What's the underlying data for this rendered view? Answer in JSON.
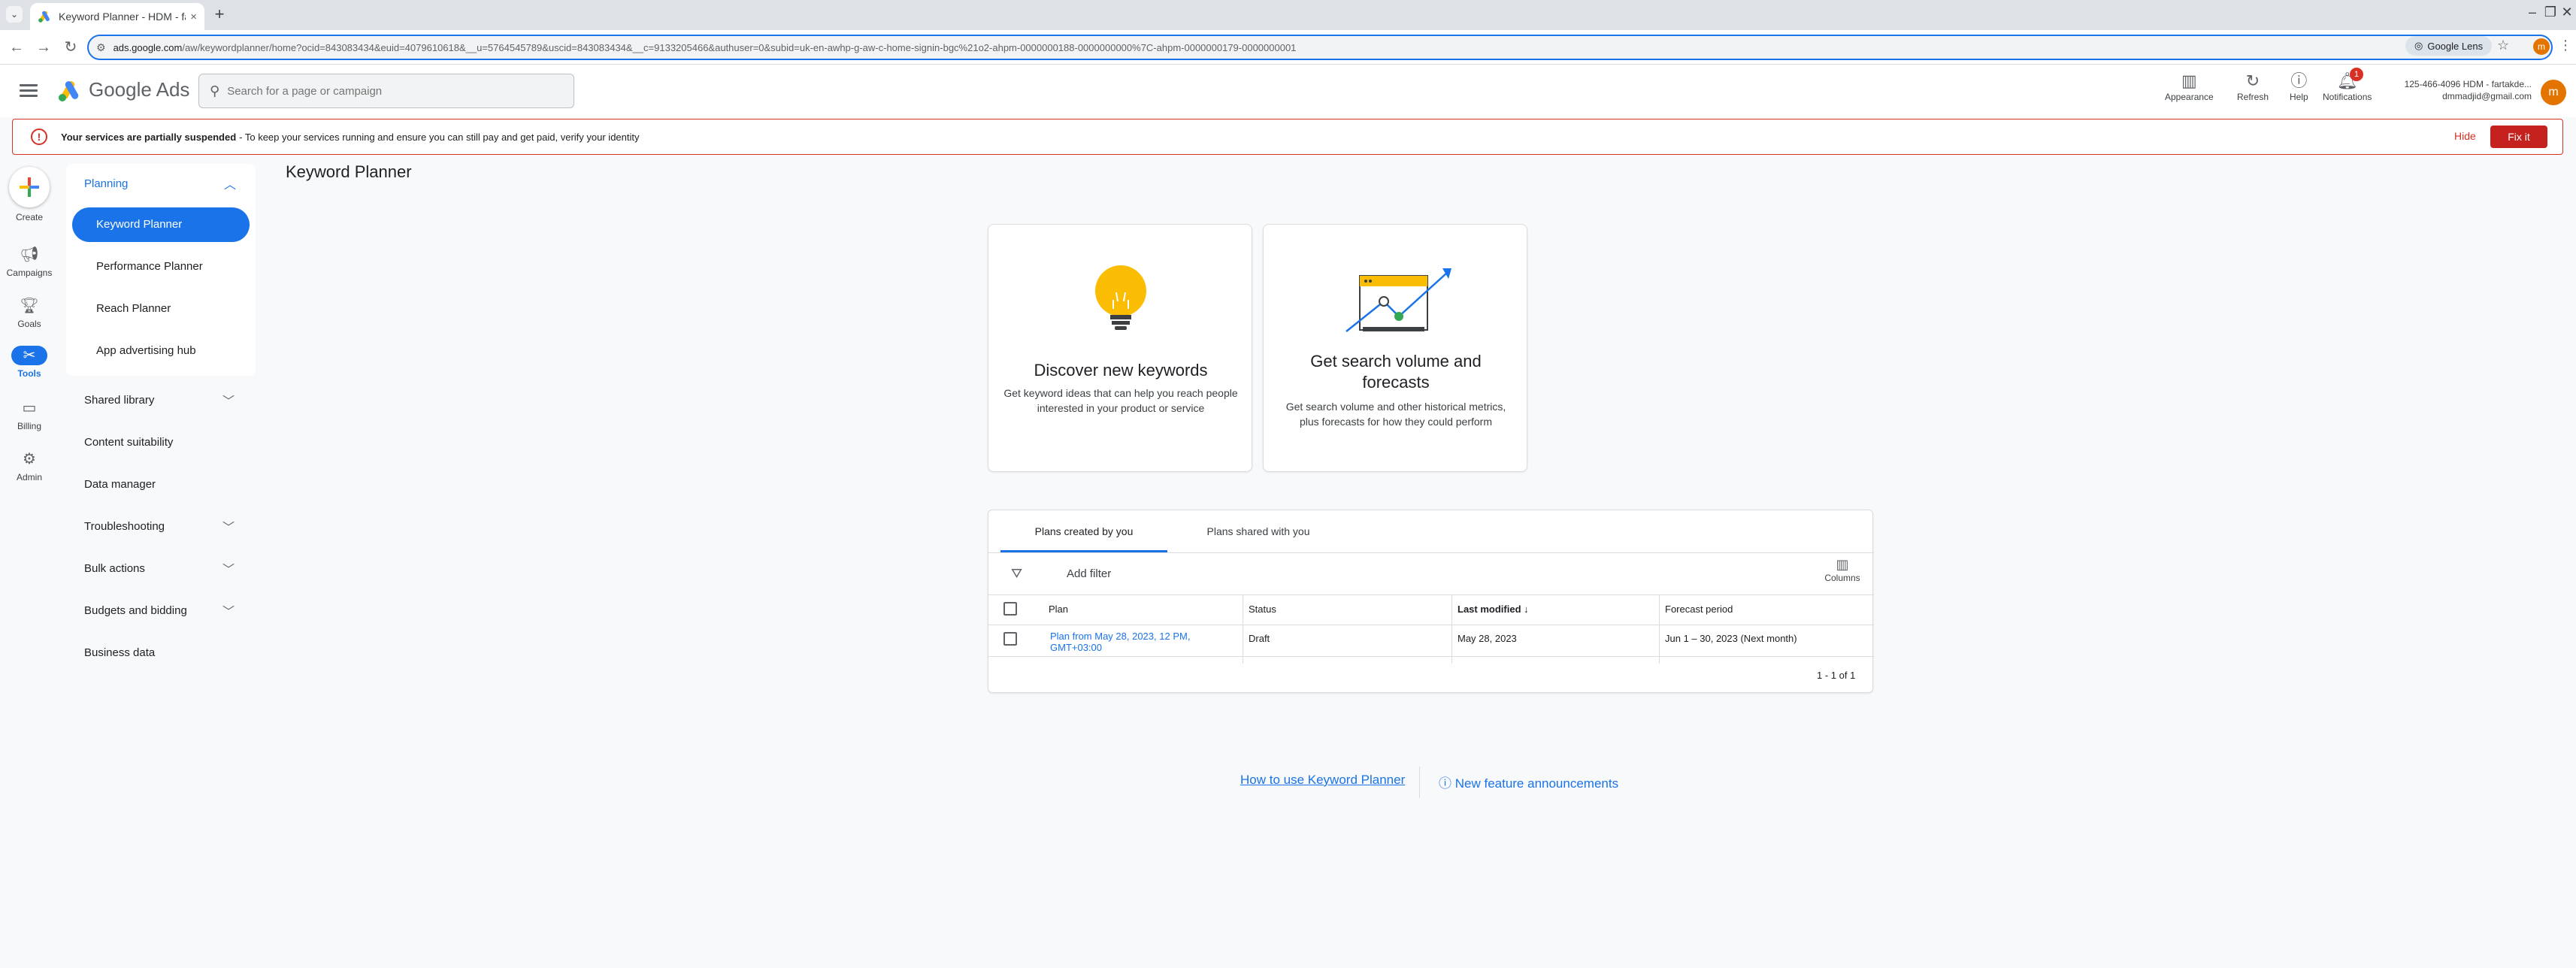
{
  "browser": {
    "tab_title": "Keyword Planner - HDM - farta...",
    "tab_close": "×",
    "tab_list": "⌄",
    "new_tab": "+",
    "url_host": "ads.google.com",
    "url_path": "/aw/keywordplanner/home?ocid=843083434&euid=4079610618&__u=5764545789&uscid=843083434&__c=9133205466&authuser=0&subid=uk-en-awhp-g-aw-c-home-signin-bgc%21o2-ahpm-0000000188-0000000000%7C-ahpm-0000000179-0000000001",
    "lens_label": "Google Lens",
    "profile_initial": "m",
    "icons": {
      "back": "arrow-left",
      "forward": "arrow-right",
      "reload": "reload",
      "star": "star",
      "menu": "kebab"
    }
  },
  "header": {
    "brand": "Google Ads",
    "search_placeholder": "Search for a page or campaign",
    "actions": [
      {
        "label": "Appearance",
        "icon": "appearance-icon"
      },
      {
        "label": "Refresh",
        "icon": "refresh-icon"
      },
      {
        "label": "Help",
        "icon": "help-icon"
      },
      {
        "label": "Notifications",
        "icon": "bell-icon"
      }
    ],
    "notification_count": "1",
    "account_id": "125-466-4096 HDM - fartakde...",
    "account_email": "dmmadjid@gmail.com",
    "avatar_initial": "m"
  },
  "banner": {
    "bold": "Your services are partially suspended",
    "text": "- To keep your services running and ensure you can still pay and get paid, verify your identity",
    "hide": "Hide",
    "fix": "Fix it",
    "color": "#d93025"
  },
  "rail": {
    "create": "Create",
    "campaigns": "Campaigns",
    "goals": "Goals",
    "tools": "Tools",
    "billing": "Billing",
    "admin": "Admin"
  },
  "sidenav": {
    "planning": "Planning",
    "planning_items": [
      "Keyword Planner",
      "Performance Planner",
      "Reach Planner",
      "App advertising hub"
    ],
    "sections": [
      "Shared library",
      "Content suitability",
      "Data manager",
      "Troubleshooting",
      "Bulk actions",
      "Budgets and bidding",
      "Business data"
    ]
  },
  "main": {
    "title": "Keyword Planner",
    "cards": [
      {
        "title": "Discover new keywords",
        "desc": "Get keyword ideas that can help you reach people interested in your product or service"
      },
      {
        "title": "Get search volume and forecasts",
        "desc": "Get search volume and other historical metrics, plus forecasts for how they could perform"
      }
    ],
    "plans": {
      "tabs": [
        "Plans created by you",
        "Plans shared with you"
      ],
      "add_filter": "Add filter",
      "columns_label": "Columns",
      "headers": [
        "Plan",
        "Status",
        "Last modified",
        "Forecast period"
      ],
      "sort_arrow": "↓",
      "rows": [
        {
          "plan": "Plan from May 28, 2023, 12 PM, GMT+03:00",
          "status": "Draft",
          "modified": "May 28, 2023",
          "forecast": "Jun 1 – 30, 2023 (Next month)"
        }
      ],
      "pager": "1 - 1 of 1"
    },
    "footer": {
      "how_to": "How to use Keyword Planner",
      "features": "New feature announcements"
    }
  },
  "colors": {
    "accent": "#1a73e8",
    "danger": "#c5221f",
    "bulb": "#fbbc04"
  }
}
